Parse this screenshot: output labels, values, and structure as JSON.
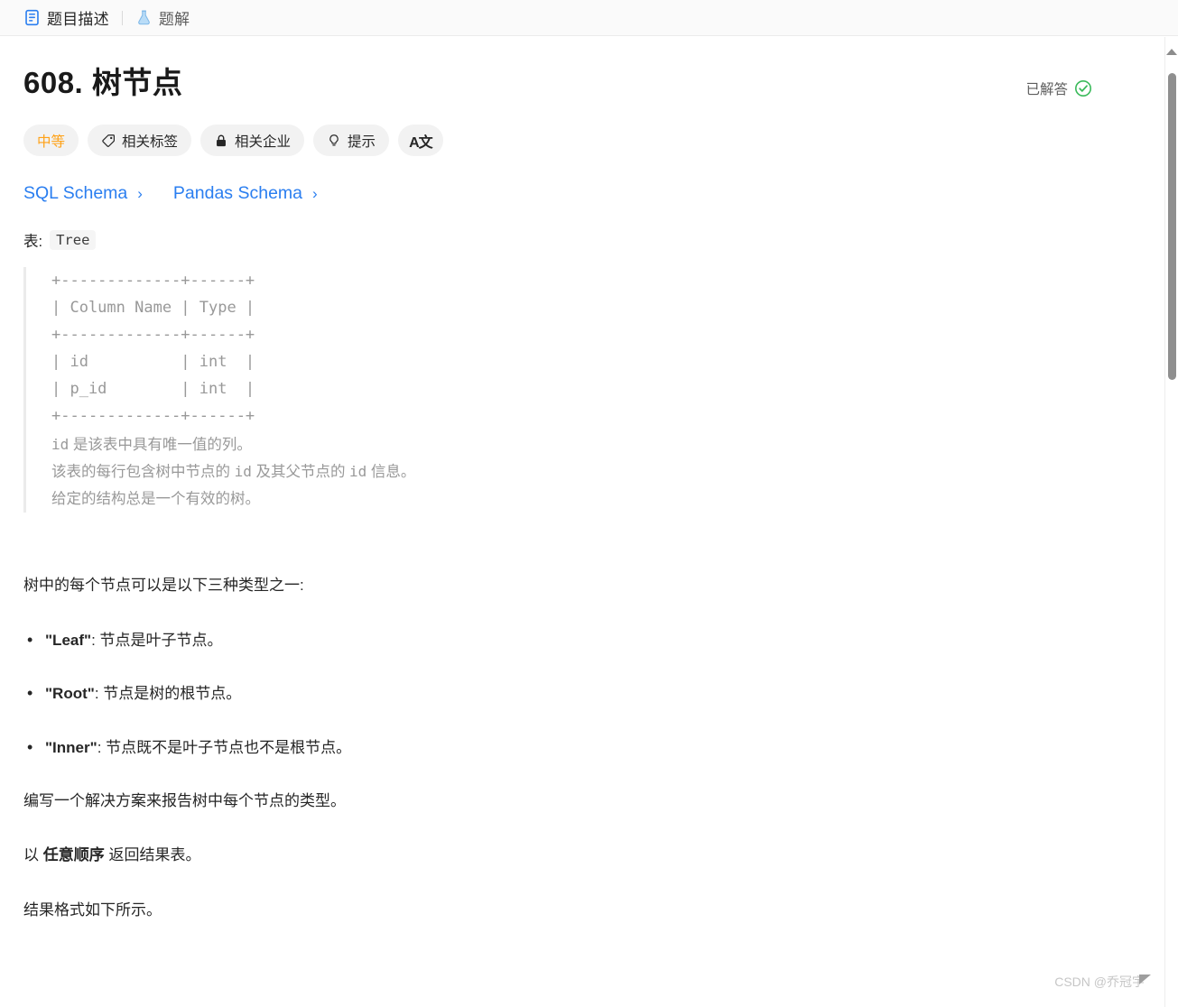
{
  "tabs": [
    {
      "label": "题目描述",
      "icon": "description-doc-icon",
      "active": true
    },
    {
      "label": "题解",
      "icon": "flask-icon",
      "active": false
    }
  ],
  "header": {
    "title": "608. 树节点",
    "solved_label": "已解答",
    "solved_icon": "check-circle-icon"
  },
  "pills": [
    {
      "label": "中等",
      "icon": null,
      "name": "difficulty-medium"
    },
    {
      "label": "相关标签",
      "icon": "tag-icon",
      "name": "related-topics"
    },
    {
      "label": "相关企业",
      "icon": "lock-icon",
      "name": "related-companies"
    },
    {
      "label": "提示",
      "icon": "lightbulb-icon",
      "name": "hint"
    },
    {
      "label": "A文",
      "icon": "translate-icon",
      "name": "translate"
    }
  ],
  "schema_links": [
    {
      "label": "SQL Schema",
      "chevron": "›"
    },
    {
      "label": "Pandas Schema",
      "chevron": "›"
    }
  ],
  "table_section": {
    "caption_prefix": "表:",
    "table_name": "Tree",
    "ascii_table": "+-------------+------+\n| Column Name | Type |\n+-------------+------+\n| id          | int  |\n| p_id        | int  |\n+-------------+------+",
    "notes": [
      {
        "code": "id",
        "rest": " 是该表中具有唯一值的列。"
      },
      {
        "pre": "该表的每行包含树中节点的 ",
        "code": "id",
        "mid": " 及其父节点的 ",
        "code2": "id",
        "post": " 信息。"
      },
      {
        "plain": "给定的结构总是一个有效的树。"
      }
    ]
  },
  "body": {
    "intro": "树中的每个节点可以是以下三种类型之一:",
    "types": [
      {
        "term": "\"Leaf\"",
        "desc": ": 节点是叶子节点。"
      },
      {
        "term": "\"Root\"",
        "desc": ": 节点是树的根节点。"
      },
      {
        "term": "\"Inner\"",
        "desc": ": 节点既不是叶子节点也不是根节点。"
      }
    ],
    "paragraph_task": "编写一个解决方案来报告树中每个节点的类型。",
    "paragraph_order_pre": "以 ",
    "paragraph_order_bold": "任意顺序",
    "paragraph_order_post": " 返回结果表。",
    "paragraph_format": "结果格式如下所示。"
  },
  "watermark": {
    "text": "CSDN @乔冠宇"
  },
  "colors": {
    "accent_blue": "#2a7ef0",
    "difficulty_medium": "#ffa116",
    "solved_green": "#3aba5a",
    "muted_text": "#999999"
  }
}
